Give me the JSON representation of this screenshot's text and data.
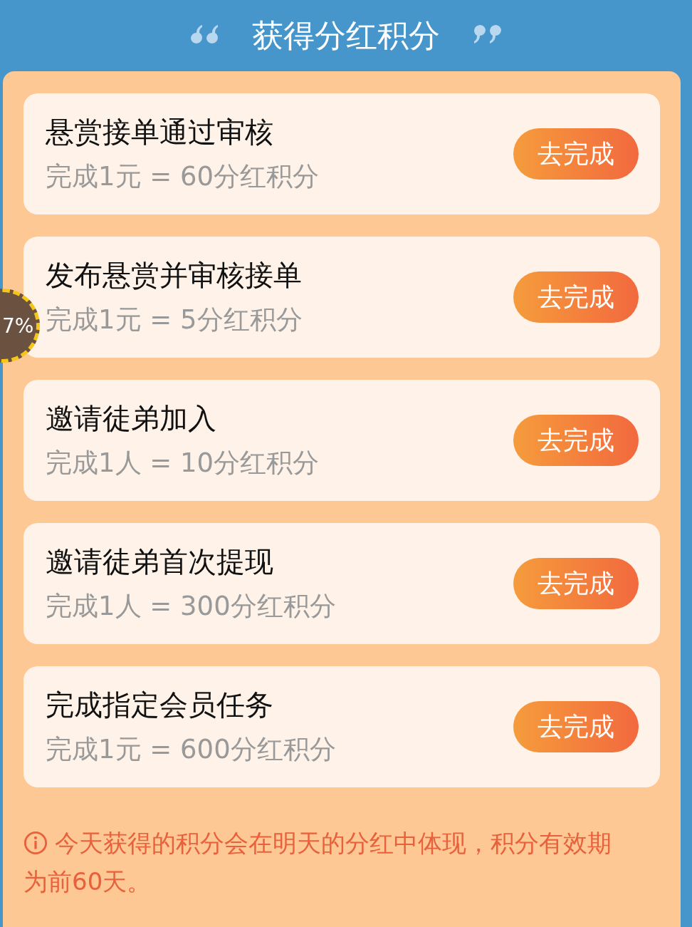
{
  "header": {
    "title": "获得分红积分"
  },
  "tasks": [
    {
      "title": "悬赏接单通过审核",
      "reward": "完成1元 = 60分红积分",
      "button": "去完成"
    },
    {
      "title": "发布悬赏并审核接单",
      "reward": "完成1元 = 5分红积分",
      "button": "去完成"
    },
    {
      "title": "邀请徒弟加入",
      "reward": "完成1人 = 10分红积分",
      "button": "去完成"
    },
    {
      "title": "邀请徒弟首次提现",
      "reward": "完成1人 = 300分红积分",
      "button": "去完成"
    },
    {
      "title": "完成指定会员任务",
      "reward": "完成1元 = 600分红积分",
      "button": "去完成"
    }
  ],
  "note": "今天获得的积分会在明天的分红中体现，积分有效期为前60天。",
  "progress_badge": {
    "text": "7%"
  }
}
